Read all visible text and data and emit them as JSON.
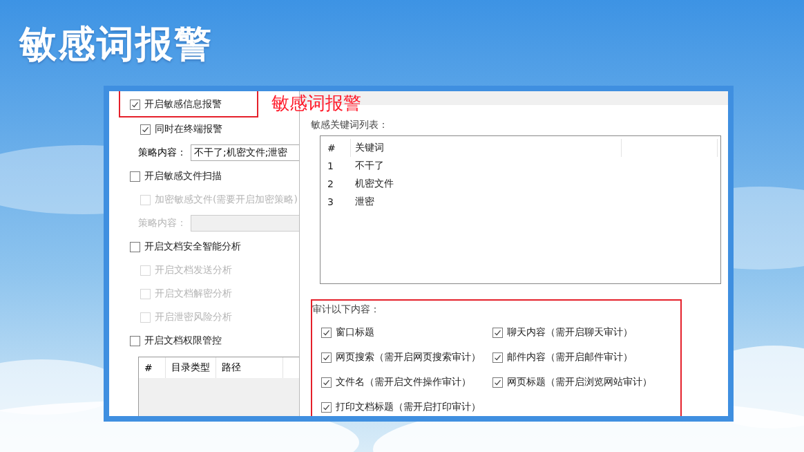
{
  "slide_title": "敏感词报警",
  "annotation": {
    "label": "敏感词报警"
  },
  "left_panel": {
    "items": [
      {
        "kind": "checkbox",
        "label": "开启敏感信息报警",
        "checked": true,
        "disabled": false,
        "annotated": true,
        "children": [
          {
            "kind": "checkbox",
            "label": "同时在终端报警",
            "checked": true,
            "disabled": false,
            "annotated": false
          },
          {
            "kind": "field",
            "label": "策略内容：",
            "value": "不干了;机密文件;泄密",
            "disabled": false
          }
        ]
      },
      {
        "kind": "checkbox",
        "label": "开启敏感文件扫描",
        "checked": false,
        "disabled": false,
        "annotated": false,
        "children": [
          {
            "kind": "checkbox",
            "label": "加密敏感文件(需要开启加密策略)",
            "checked": false,
            "disabled": true,
            "annotated": false
          },
          {
            "kind": "field",
            "label": "策略内容：",
            "disabled": true
          }
        ]
      },
      {
        "kind": "checkbox",
        "label": "开启文档安全智能分析",
        "checked": false,
        "disabled": false,
        "annotated": false,
        "children": [
          {
            "kind": "checkbox",
            "label": "开启文档发送分析",
            "checked": false,
            "disabled": true,
            "annotated": false
          },
          {
            "kind": "checkbox",
            "label": "开启文档解密分析",
            "checked": false,
            "disabled": true,
            "annotated": false
          },
          {
            "kind": "checkbox",
            "label": "开启泄密风险分析",
            "checked": false,
            "disabled": true,
            "annotated": false
          }
        ]
      },
      {
        "kind": "checkbox",
        "label": "开启文档权限管控",
        "checked": false,
        "disabled": false,
        "annotated": false,
        "children": [
          {
            "kind": "table",
            "columns": [
              "#",
              "目录类型",
              "路径"
            ]
          }
        ]
      }
    ]
  },
  "dialog": {
    "keyword_list": {
      "label": "敏感关键词列表：",
      "columns": [
        "#",
        "关键词"
      ],
      "rows": [
        [
          "1",
          "不干了"
        ],
        [
          "2",
          "机密文件"
        ],
        [
          "3",
          "泄密"
        ]
      ]
    },
    "audit": {
      "label": "审计以下内容：",
      "annotated": true,
      "options": [
        {
          "label": "窗口标题",
          "checked": true
        },
        {
          "label": "聊天内容（需开启聊天审计）",
          "checked": true
        },
        {
          "label": "网页搜索（需开启网页搜索审计）",
          "checked": true
        },
        {
          "label": "邮件内容（需开启邮件审计）",
          "checked": true
        },
        {
          "label": "文件名（需开启文件操作审计）",
          "checked": true
        },
        {
          "label": "网页标题（需开启浏览网站审计）",
          "checked": true
        },
        {
          "label": "打印文档标题（需开启打印审计）",
          "checked": true
        }
      ]
    }
  }
}
